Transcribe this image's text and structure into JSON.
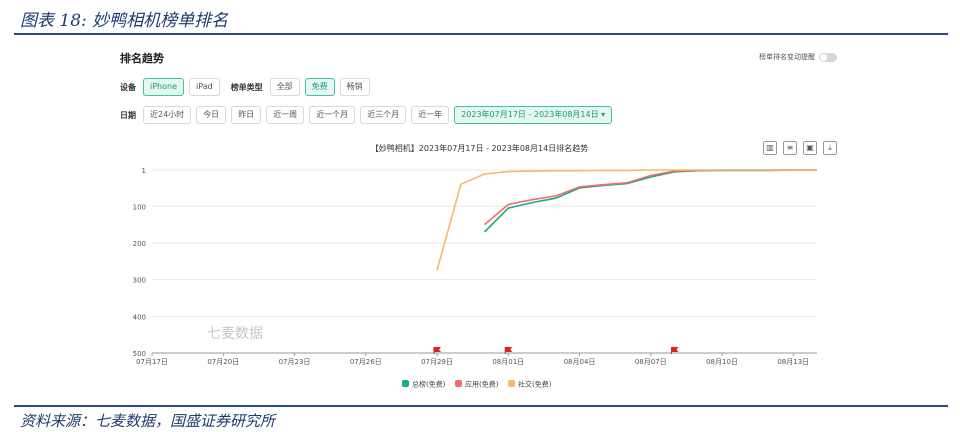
{
  "figure_title": "图表 18: 妙鸭相机榜单排名",
  "source": "资料来源：七麦数据，国盛证券研究所",
  "panel": {
    "section_title": "排名趋势",
    "toggle_label": "榜单排名变动提醒",
    "device_label": "设备",
    "devices": [
      "iPhone",
      "iPad"
    ],
    "list_type_label": "榜单类型",
    "list_types": [
      "全部",
      "免费",
      "畅销"
    ],
    "date_label": "日期",
    "date_options": [
      "近24小时",
      "今日",
      "昨日",
      "近一周",
      "近一个月",
      "近三个月",
      "近一年"
    ],
    "date_range": "2023年07月17日 - 2023年08月14日 ▾",
    "chart_title": "【妙鸭相机】2023年07月17日 - 2023年08月14日排名趋势",
    "watermark": "七麦数据",
    "icons": [
      "bar-chart-icon",
      "list-icon",
      "image-icon",
      "download-icon"
    ]
  },
  "colors": {
    "total": "#1bab80",
    "app": "#f36b6b",
    "social": "#f7b86a",
    "active_chip": "#3fc4a3",
    "flag": "#e02020"
  },
  "chart_data": {
    "type": "line",
    "title": "【妙鸭相机】2023年07月17日 - 2023年08月14日排名趋势",
    "x_ticks": [
      "07月17日",
      "07月20日",
      "07月23日",
      "07月26日",
      "07月29日",
      "08月01日",
      "08月04日",
      "08月07日",
      "08月10日",
      "08月13日"
    ],
    "x_range": [
      "2023-07-17",
      "2023-08-14"
    ],
    "y_ticks": [
      "1",
      "100",
      "200",
      "300",
      "400",
      "500"
    ],
    "ylim": [
      500,
      1
    ],
    "y_inverted": true,
    "grid": true,
    "legend_position": "bottom",
    "flags_at": [
      "2023-07-29",
      "2023-08-01",
      "2023-08-08"
    ],
    "series": [
      {
        "name": "总榜(免费)",
        "color": "#1bab80",
        "points": [
          {
            "x": "2023-07-31",
            "y": 170
          },
          {
            "x": "2023-08-01",
            "y": 105
          },
          {
            "x": "2023-08-02",
            "y": 90
          },
          {
            "x": "2023-08-03",
            "y": 78
          },
          {
            "x": "2023-08-04",
            "y": 50
          },
          {
            "x": "2023-08-05",
            "y": 43
          },
          {
            "x": "2023-08-06",
            "y": 38
          },
          {
            "x": "2023-08-07",
            "y": 20
          },
          {
            "x": "2023-08-08",
            "y": 6
          },
          {
            "x": "2023-08-09",
            "y": 3
          },
          {
            "x": "2023-08-10",
            "y": 2
          },
          {
            "x": "2023-08-11",
            "y": 2
          },
          {
            "x": "2023-08-12",
            "y": 2
          },
          {
            "x": "2023-08-13",
            "y": 1
          },
          {
            "x": "2023-08-14",
            "y": 1
          }
        ]
      },
      {
        "name": "应用(免费)",
        "color": "#f36b6b",
        "points": [
          {
            "x": "2023-07-31",
            "y": 150
          },
          {
            "x": "2023-08-01",
            "y": 95
          },
          {
            "x": "2023-08-02",
            "y": 82
          },
          {
            "x": "2023-08-03",
            "y": 72
          },
          {
            "x": "2023-08-04",
            "y": 47
          },
          {
            "x": "2023-08-05",
            "y": 41
          },
          {
            "x": "2023-08-06",
            "y": 36
          },
          {
            "x": "2023-08-07",
            "y": 16
          },
          {
            "x": "2023-08-08",
            "y": 4
          },
          {
            "x": "2023-08-09",
            "y": 2
          },
          {
            "x": "2023-08-10",
            "y": 1
          },
          {
            "x": "2023-08-11",
            "y": 1
          },
          {
            "x": "2023-08-12",
            "y": 1
          },
          {
            "x": "2023-08-13",
            "y": 1
          },
          {
            "x": "2023-08-14",
            "y": 1
          }
        ]
      },
      {
        "name": "社交(免费)",
        "color": "#f7b86a",
        "points": [
          {
            "x": "2023-07-29",
            "y": 275
          },
          {
            "x": "2023-07-30",
            "y": 40
          },
          {
            "x": "2023-07-31",
            "y": 12
          },
          {
            "x": "2023-08-01",
            "y": 5
          },
          {
            "x": "2023-08-02",
            "y": 4
          },
          {
            "x": "2023-08-03",
            "y": 3
          },
          {
            "x": "2023-08-04",
            "y": 3
          },
          {
            "x": "2023-08-05",
            "y": 2
          },
          {
            "x": "2023-08-06",
            "y": 2
          },
          {
            "x": "2023-08-07",
            "y": 1
          },
          {
            "x": "2023-08-08",
            "y": 1
          },
          {
            "x": "2023-08-09",
            "y": 1
          },
          {
            "x": "2023-08-10",
            "y": 1
          },
          {
            "x": "2023-08-11",
            "y": 1
          },
          {
            "x": "2023-08-12",
            "y": 1
          },
          {
            "x": "2023-08-13",
            "y": 1
          },
          {
            "x": "2023-08-14",
            "y": 1
          }
        ]
      }
    ]
  }
}
